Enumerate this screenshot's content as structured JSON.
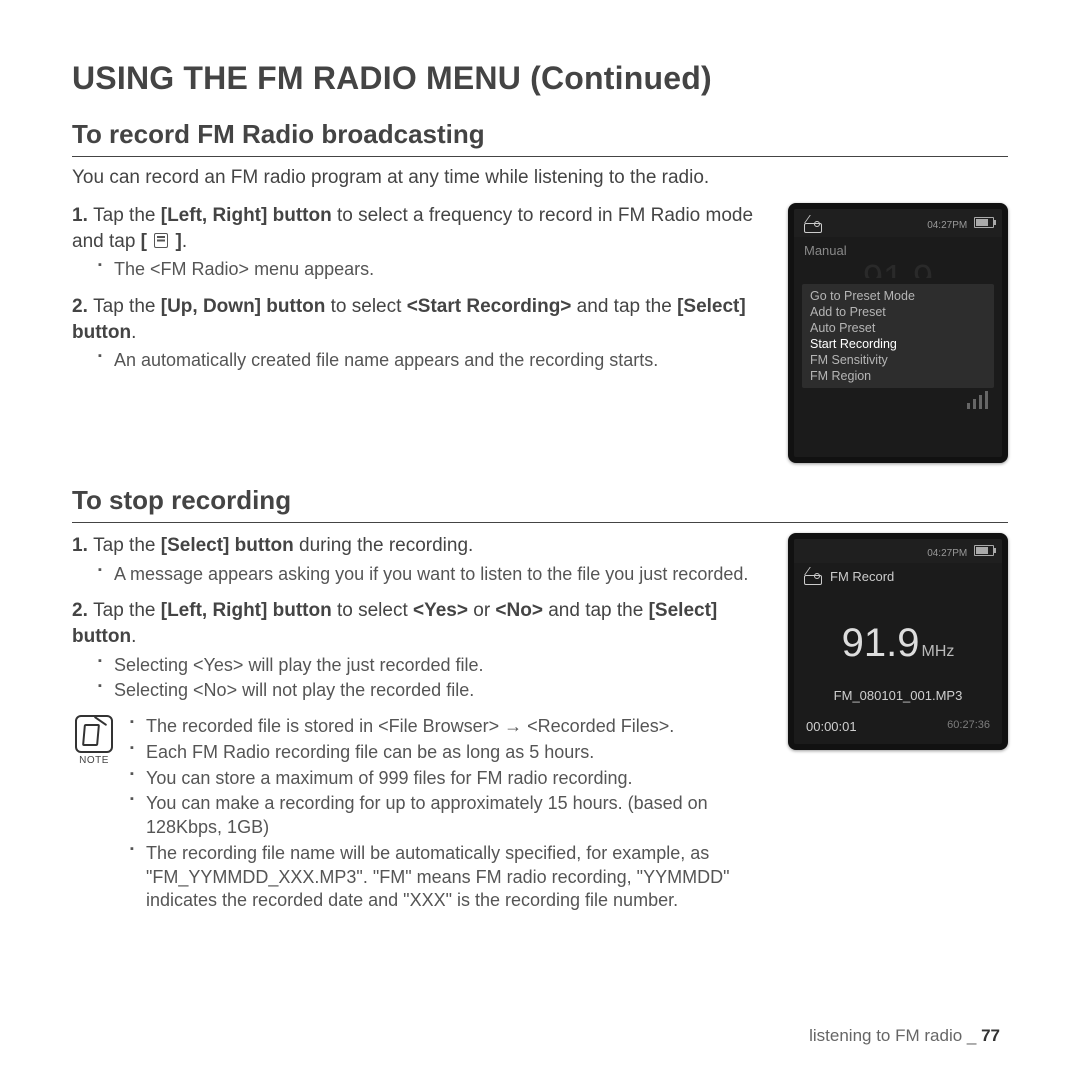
{
  "title": "USING THE FM RADIO MENU (Continued)",
  "section1": {
    "heading": "To record FM Radio broadcasting",
    "intro": "You can record an FM radio program at any time while listening to the radio.",
    "step1_a": "Tap the ",
    "step1_b": "[Left, Right] button",
    "step1_c": " to select a frequency to record in FM Radio mode and tap ",
    "step1_d": "[ ",
    "step1_e": " ]",
    "step1_f": ".",
    "step1_sub": "The <FM Radio> menu appears.",
    "step2_a": "Tap the ",
    "step2_b": "[Up, Down] button",
    "step2_c": " to select ",
    "step2_d": "<Start Recording>",
    "step2_e": " and tap the ",
    "step2_f": "[Select] button",
    "step2_g": ".",
    "step2_sub": "An automatically created file name appears and the recording starts."
  },
  "device1": {
    "time": "04:27PM",
    "mode": "Manual",
    "menu": [
      "Go to Preset Mode",
      "Add to Preset",
      "Auto Preset",
      "Start Recording",
      "FM Sensitivity",
      "FM Region"
    ],
    "selected_index": 3
  },
  "section2": {
    "heading": "To stop recording",
    "step1_a": "Tap the ",
    "step1_b": "[Select] button",
    "step1_c": " during the recording.",
    "step1_sub": "A message appears asking you if you want to listen to the file you just recorded.",
    "step2_a": "Tap the ",
    "step2_b": "[Left, Right] button",
    "step2_c": " to select ",
    "step2_d": "<Yes>",
    "step2_e": " or ",
    "step2_f": "<No>",
    "step2_g": " and tap the ",
    "step2_h": "[Select] button",
    "step2_i": ".",
    "step2_sub1": "Selecting <Yes> will play the just recorded file.",
    "step2_sub2": "Selecting <No> will not play the recorded file."
  },
  "device2": {
    "time": "04:27PM",
    "title": "FM Record",
    "freq": "91.9",
    "unit": "MHz",
    "filename": "FM_080101_001.MP3",
    "elapsed": "00:00:01",
    "remaining": "60:27:36"
  },
  "note": {
    "label": "NOTE",
    "items": [
      "The recorded file is stored in <File Browser> → <Recorded Files>.",
      "Each FM Radio recording file can be as long as 5 hours.",
      "You can store a maximum of 999 files for FM radio recording.",
      "You can make a recording for up to approximately 15 hours. (based on 128Kbps, 1GB)",
      "The recording file name will be automatically specified, for example, as \"FM_YYMMDD_XXX.MP3\". \"FM\" means FM radio recording, \"YYMMDD\" indicates the recorded date and \"XXX\" is the recording file number."
    ]
  },
  "footer": {
    "section": "listening to FM radio _ ",
    "page": "77"
  }
}
